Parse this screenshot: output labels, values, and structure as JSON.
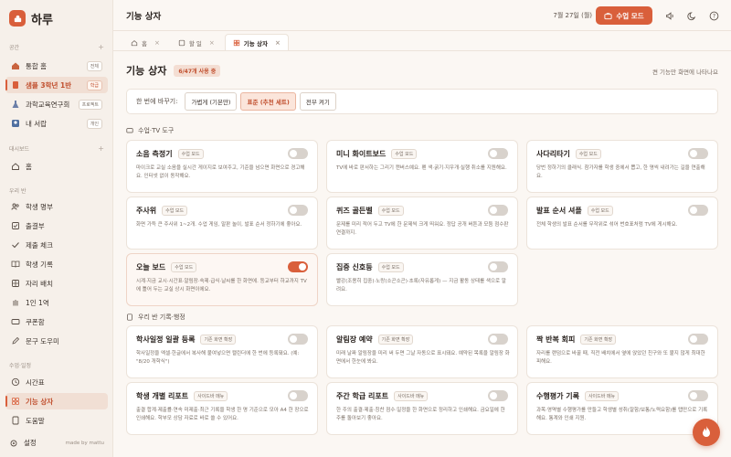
{
  "app": {
    "name": "하루"
  },
  "sidebar": {
    "sections": [
      {
        "label": "공간"
      },
      {
        "label": "대시보드"
      },
      {
        "label": "우리 반"
      },
      {
        "label": "수업·일정"
      }
    ],
    "spaces": [
      {
        "label": "통합 홈",
        "badge": "전체"
      },
      {
        "label": "샘플 3학년 1반",
        "badge": "학급"
      },
      {
        "label": "과학교육연구회",
        "badge": "프로젝트"
      },
      {
        "label": "내 서랍",
        "badge": "개인"
      }
    ],
    "dashboard": [
      {
        "label": "홈"
      }
    ],
    "class": [
      {
        "label": "학생 명부"
      },
      {
        "label": "출결부"
      },
      {
        "label": "제출 체크"
      },
      {
        "label": "학생 기록"
      },
      {
        "label": "자리 배치"
      },
      {
        "label": "1인 1역"
      },
      {
        "label": "쿠폰함"
      },
      {
        "label": "문구 도우미"
      }
    ],
    "schedule": [
      {
        "label": "시간표"
      },
      {
        "label": "기능 상자"
      },
      {
        "label": "도움말"
      }
    ],
    "footer": {
      "settings": "설정",
      "made_by": "made by mattu"
    }
  },
  "topbar": {
    "title": "기능 상자",
    "date": "7월 27일 (월)",
    "class_mode": "수업 모드"
  },
  "tabs": [
    {
      "label": "홈"
    },
    {
      "label": "할 일"
    },
    {
      "label": "기능 상자"
    }
  ],
  "main": {
    "title": "기능 상자",
    "usage": "6/47개 사용 중",
    "hint": "켠 기능만 화면에 나타나요",
    "preset": {
      "label": "한 번에 바꾸기:",
      "options": [
        "가볍게 (기본만)",
        "표준 (추천 세트)",
        "전부 켜기"
      ]
    },
    "section1": "수업·TV 도구",
    "section2": "우리 반 기록·행정",
    "cards": [
      {
        "title": "소음 측정기",
        "tag": "수업 모드",
        "desc": "마이크로 교실 소음을 실시간 게이지로 보여주고, 기준을 넘으면 화면으로 경고해요. 인터넷 없이 동작해요.",
        "on": false
      },
      {
        "title": "미니 화이트보드",
        "tag": "수업 모드",
        "desc": "TV에 바로 판서하는 그리기 캔버스예요. 펜 색·굵기·지우개·실행 취소를 지원해요.",
        "on": false
      },
      {
        "title": "사다리타기",
        "tag": "수업 모드",
        "desc": "당번 정하기의 클래식. 참가자를 학생 중에서 뽑고, 한 명씩 내려가는 길을 연출해요.",
        "on": false
      },
      {
        "title": "주사위",
        "tag": "수업 모드",
        "desc": "화면 가득 큰 주사위 1~2개. 수업 게임, 말판 놀이, 발표 순서 정하기에 좋아요.",
        "on": false
      },
      {
        "title": "퀴즈 골든벨",
        "tag": "수업 모드",
        "desc": "문제를 미리 적어 두고 TV에 한 문제씩 크게 띄워요. 정답 공개 버튼과 모둠 점수판 연결까지.",
        "on": false
      },
      {
        "title": "발표 순서 셔플",
        "tag": "수업 모드",
        "desc": "전체 학생의 발표 순서를 무작위로 섞어 번호표처럼 TV에 게시해요.",
        "on": false
      },
      {
        "title": "오늘 보드",
        "tag": "수업 모드",
        "desc": "시계·지금 교시·시간표·알림장·숙제·급식·날씨를 한 화면에. 등교부터 하교까지 TV에 틀어 두는 교실 상시 화면이에요.",
        "on": true
      },
      {
        "title": "집중 신호등",
        "tag": "수업 모드",
        "desc": "빨강(조용히 집중)·노랑(소곤소곤)·초록(자유롭게) — 지금 활동 상태를 색으로 알려요.",
        "on": false
      },
      {
        "title": "학사일정 일괄 등록",
        "tag": "기존 화면 확장",
        "desc": "학사일정을 엑셀·한글에서 복사해 붙여넣으면 캘린더에 한 번에 등록돼요. (예: \"8/20 개학식\")",
        "on": false
      },
      {
        "title": "알림장 예약",
        "tag": "기존 화면 확장",
        "desc": "미래 날짜 알림장을 미리 써 두면 그날 자동으로 표시돼요. 예약된 목록을 알림장 화면에서 한눈에 봐요.",
        "on": false
      },
      {
        "title": "짝 반복 회피",
        "tag": "기존 화면 확장",
        "desc": "자리를 랜덤으로 바꿀 때, 직전 배치에서 옆에 앉았던 친구와 또 붙지 않게 최대한 피해요.",
        "on": false
      },
      {
        "title": "학생 개별 리포트",
        "tag": "사이드바 메뉴",
        "desc": "출결 합계·제출률·연속 미제출·최근 기록을 학생 한 명 기준으로 모아 A4 한 장으로 인쇄해요. 학부모 상담 자료로 바로 쓸 수 있어요.",
        "on": false
      },
      {
        "title": "주간 학급 리포트",
        "tag": "사이드바 메뉴",
        "desc": "한 주의 출결·제출·칭찬 점수·일정을 한 화면으로 정리하고 인쇄해요. 금요일에 한 주를 돌아보기 좋아요.",
        "on": false
      },
      {
        "title": "수행평가 기록",
        "tag": "사이드바 메뉴",
        "desc": "과목·영역별 수행평가를 만들고 학생별 성취(잘함/보통/노력요함)를 탭만으로 기록해요. 통계와 인쇄 지원.",
        "on": false
      }
    ]
  },
  "colors": {
    "accent": "#d95f3b",
    "background": "#fbf7f3",
    "sidebar": "#f6f0ea"
  }
}
